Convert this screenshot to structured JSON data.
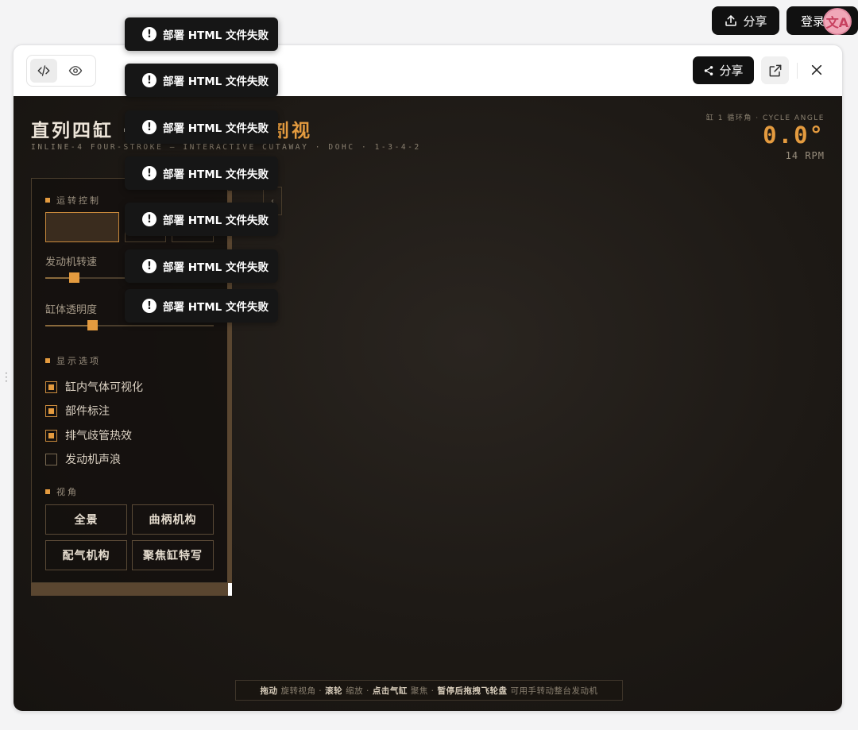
{
  "page": {
    "share_label": "分享",
    "login_label": "登录",
    "avatar_text": "文A"
  },
  "window": {
    "share_label": "分享"
  },
  "stage": {
    "title": "直列四缸 ·",
    "title_accent": "剖视",
    "subtitle": "INLINE-4 FOUR-STROKE — INTERACTIVE CUTAWAY · DOHC · 1-3-4-2",
    "cycle_label": "缸 1 循环角 · CYCLE ANGLE",
    "cycle_value": "0.0°",
    "rpm": "14 RPM",
    "accent_color": "#e49b3f"
  },
  "panel": {
    "section_run": "运转控制",
    "rpm_label": "发动机转速",
    "rpm_level": 0.17,
    "opacity_label": "缸体透明度",
    "opacity_level": 0.28,
    "section_display": "显示选项",
    "options": [
      {
        "label": "缸内气体可视化",
        "checked": true
      },
      {
        "label": "部件标注",
        "checked": true
      },
      {
        "label": "排气歧管热效",
        "checked": true
      },
      {
        "label": "发动机声浪",
        "checked": false
      }
    ],
    "section_view": "视角",
    "views": [
      "全景",
      "曲柄机构",
      "配气机构",
      "聚焦缸特写"
    ],
    "collapse_icon": "‹"
  },
  "hint": {
    "drag": "拖动",
    "drag_desc": "旋转视角 ·",
    "wheel": "滚轮",
    "wheel_desc": "缩放 ·",
    "click": "点击气缸",
    "click_desc": "聚焦 ·",
    "pause": "暂停后拖拽飞轮盘",
    "pause_desc": "可用手转动整台发动机"
  },
  "toasts": [
    "部署 HTML 文件失败",
    "部署 HTML 文件失败",
    "部署 HTML 文件失败",
    "部署 HTML 文件失败",
    "部署 HTML 文件失败",
    "部署 HTML 文件失败",
    "部署 HTML 文件失败"
  ]
}
